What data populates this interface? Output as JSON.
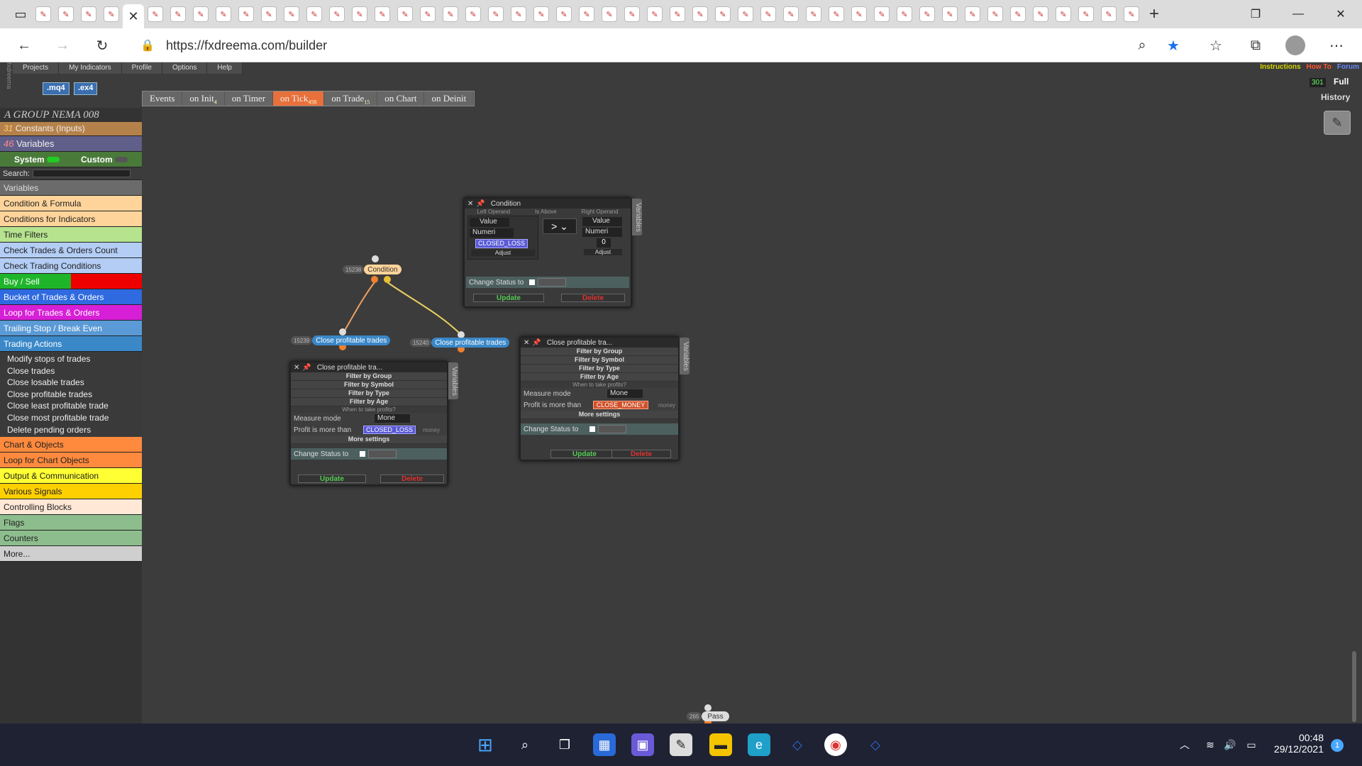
{
  "browser": {
    "url": "https://fxdreema.com/builder"
  },
  "app": {
    "menu": [
      "Projects",
      "My Indicators",
      "Profile",
      "Options",
      "Help"
    ],
    "links": [
      {
        "label": "Instructions",
        "color": "#d4d400"
      },
      {
        "label": "How To",
        "color": "#ff5533"
      },
      {
        "label": "Forum",
        "color": "#6688ff"
      }
    ],
    "mq4": ".mq4",
    "ex4": ".ex4",
    "counter": "301",
    "full": "Full",
    "history": "History",
    "events": [
      {
        "label": "Events",
        "badge": ""
      },
      {
        "label": "on Init",
        "badge": "4"
      },
      {
        "label": "on Timer",
        "badge": ""
      },
      {
        "label": "on Tick",
        "badge": "458",
        "active": true
      },
      {
        "label": "on Trade",
        "badge": "15"
      },
      {
        "label": "on Chart",
        "badge": ""
      },
      {
        "label": "on Deinit",
        "badge": ""
      }
    ]
  },
  "sidebar": {
    "project": "A GROUP NEMA 008",
    "constants_count": "31",
    "constants": "Constants (Inputs)",
    "variables_count": "46",
    "variables": "Variables",
    "system": "System",
    "custom": "Custom",
    "search": "Search:",
    "categories": [
      {
        "label": "Variables",
        "bg": "#6b6b6b",
        "fg": "#ddd"
      },
      {
        "label": "Condition & Formula",
        "bg": "#ffd49a",
        "fg": "#222"
      },
      {
        "label": "Conditions for Indicators",
        "bg": "#ffd49a",
        "fg": "#222"
      },
      {
        "label": "Time Filters",
        "bg": "#b6e38e",
        "fg": "#222"
      },
      {
        "label": "Check Trades & Orders Count",
        "bg": "#b3cdf5",
        "fg": "#222"
      },
      {
        "label": "Check Trading Conditions",
        "bg": "#b3cdf5",
        "fg": "#222"
      },
      {
        "label": "Buy / Sell",
        "bg": "#1fb52a",
        "fg": "#fff"
      },
      {
        "label": "Bucket of Trades & Orders",
        "bg": "#2f6ae0",
        "fg": "#fff"
      },
      {
        "label": "Loop for Trades & Orders",
        "bg": "#d61fd6",
        "fg": "#fff"
      },
      {
        "label": "Trailing Stop / Break Even",
        "bg": "#5a9ad6",
        "fg": "#fff"
      },
      {
        "label": "Trading Actions",
        "bg": "#3a88c8",
        "fg": "#fff"
      }
    ],
    "trading_actions": [
      "Modify stops of trades",
      "Close trades",
      "Close losable trades",
      "Close profitable trades",
      "Close least profitable trade",
      "Close most profitable trade",
      "Delete pending orders"
    ],
    "categories2": [
      {
        "label": "Chart & Objects",
        "bg": "#ff8a3d",
        "fg": "#222"
      },
      {
        "label": "Loop for Chart Objects",
        "bg": "#ff8a3d",
        "fg": "#222"
      },
      {
        "label": "Output & Communication",
        "bg": "#ffff33",
        "fg": "#222"
      },
      {
        "label": "Various Signals",
        "bg": "#ffd000",
        "fg": "#222"
      },
      {
        "label": "Controlling Blocks",
        "bg": "#ffe8d6",
        "fg": "#222"
      },
      {
        "label": "Flags",
        "bg": "#8dbd8d",
        "fg": "#222"
      },
      {
        "label": "Counters",
        "bg": "#8dbd8d",
        "fg": "#222"
      },
      {
        "label": "More...",
        "bg": "#cfcfcf",
        "fg": "#222"
      }
    ]
  },
  "canvas": {
    "condition_node": {
      "id": "15238",
      "label": "Condition"
    },
    "close_node_1": {
      "id": "15239",
      "label": "Close profitable trades"
    },
    "close_node_2": {
      "id": "15240",
      "label": "Close profitable trades"
    },
    "pass_node": {
      "id": "265",
      "label": "Pass"
    },
    "condition_panel": {
      "title": "Condition",
      "left_label": "Left Operand",
      "is_above": "Is Above",
      "right_label": "Right Operand",
      "left_type": "Value",
      "left_kind": "Numeri",
      "left_value": "CLOSED_LOSS",
      "adjust": "Adjust",
      "operator": ">",
      "right_type": "Value",
      "right_kind": "Numeri",
      "right_value": "0",
      "change_status": "Change Status to",
      "update": "Update",
      "delete": "Delete",
      "variables": "Variables"
    },
    "close_panel_1": {
      "title": "Close profitable tra...",
      "rows": [
        "Filter by Group",
        "Filter by Symbol",
        "Filter by Type",
        "Filter by Age"
      ],
      "when": "When to take profits?",
      "measure_label": "Measure mode",
      "measure_value": "Mone",
      "profit_label": "Profit is more than",
      "profit_value": "CLOSED_LOSS",
      "unit": "money",
      "more": "More settings",
      "change_status": "Change Status to",
      "update": "Update",
      "delete": "Delete",
      "variables": "Variables"
    },
    "close_panel_2": {
      "title": "Close profitable tra...",
      "rows": [
        "Filter by Group",
        "Filter by Symbol",
        "Filter by Type",
        "Filter by Age"
      ],
      "when": "When to take profits?",
      "measure_label": "Measure mode",
      "measure_value": "Mone",
      "profit_label": "Profit is more than",
      "profit_value": "CLOSE_MONEY",
      "unit": "money",
      "more": "More settings",
      "change_status": "Change Status to",
      "update": "Update",
      "delete": "Delete",
      "variables": "Variables"
    }
  },
  "taskbar": {
    "time": "00:48",
    "date": "29/12/2021",
    "notif": "1"
  }
}
